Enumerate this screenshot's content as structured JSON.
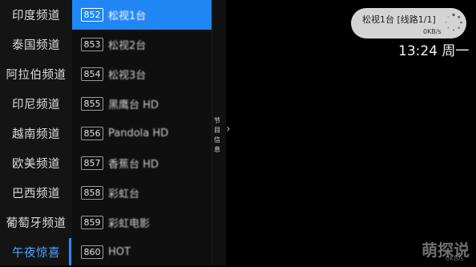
{
  "categories": [
    {
      "label": "印度频道"
    },
    {
      "label": "泰国频道"
    },
    {
      "label": "阿拉伯频道"
    },
    {
      "label": "印尼频道"
    },
    {
      "label": "越南频道"
    },
    {
      "label": "欧美频道"
    },
    {
      "label": "巴西频道"
    },
    {
      "label": "葡萄牙频道"
    },
    {
      "label": "午夜惊喜"
    }
  ],
  "active_category": "午夜惊喜",
  "channels": [
    {
      "number": "852",
      "name": "松视1台"
    },
    {
      "number": "853",
      "name": "松视2台"
    },
    {
      "number": "854",
      "name": "松视3台"
    },
    {
      "number": "855",
      "name": "黑鹰台 HD"
    },
    {
      "number": "856",
      "name": "Pandola HD"
    },
    {
      "number": "857",
      "name": "香蕉台 HD"
    },
    {
      "number": "858",
      "name": "彩虹台"
    },
    {
      "number": "859",
      "name": "彩虹电影"
    },
    {
      "number": "860",
      "name": "HOT"
    }
  ],
  "selected_channel": "852",
  "program_info": {
    "label": "节目信息",
    "chevron": "›"
  },
  "now_playing": {
    "title": "松视1台 [线路1/1]",
    "speed": "0KB/s",
    "spinner_icon": "loading-spinner-icon"
  },
  "clock": "13:24 周一",
  "watermark": {
    "text": "萌探说",
    "sub": "0KB/s"
  },
  "colors": {
    "selected": "#1f86f3",
    "active_category": "#4fa3ff"
  }
}
